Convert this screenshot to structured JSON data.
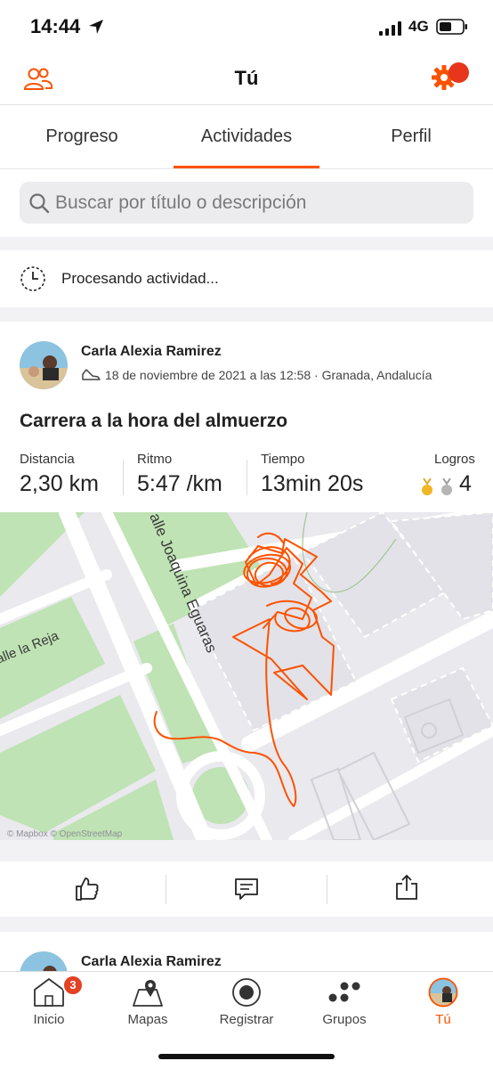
{
  "status_bar": {
    "time": "14:44",
    "network": "4G"
  },
  "header": {
    "title": "Tú"
  },
  "tabs": [
    {
      "label": "Progreso"
    },
    {
      "label": "Actividades"
    },
    {
      "label": "Perfil"
    }
  ],
  "search": {
    "placeholder": "Buscar por título o descripción"
  },
  "processing": {
    "text": "Procesando actividad..."
  },
  "activity": {
    "athlete": "Carla Alexia Ramirez",
    "meta": "18 de noviembre de 2021 a las 12:58 · Granada, Andalucía",
    "title": "Carrera a la hora del almuerzo",
    "stats": [
      {
        "label": "Distancia",
        "value": "2,30 km"
      },
      {
        "label": "Ritmo",
        "value": "5:47 /km"
      },
      {
        "label": "Tiempo",
        "value": "13min 20s"
      },
      {
        "label": "Logros",
        "value": "4"
      }
    ],
    "map": {
      "street_1": "alle Joaquina Eguaras",
      "street_2": "alle la Reja",
      "attribution": "© Mapbox © OpenStreetMap",
      "route_color": "#fc5200"
    }
  },
  "next_activity": {
    "athlete": "Carla Alexia Ramirez"
  },
  "bottom_nav": [
    {
      "label": "Inicio",
      "icon": "home-icon",
      "badge": "3"
    },
    {
      "label": "Mapas",
      "icon": "map-icon"
    },
    {
      "label": "Registrar",
      "icon": "record-icon"
    },
    {
      "label": "Grupos",
      "icon": "groups-icon"
    },
    {
      "label": "Tú",
      "icon": "profile-avatar-icon"
    }
  ],
  "colors": {
    "accent": "#fc5200",
    "badge": "#e34224",
    "map_park": "#bfe3b4",
    "map_block": "#eaeaee"
  }
}
